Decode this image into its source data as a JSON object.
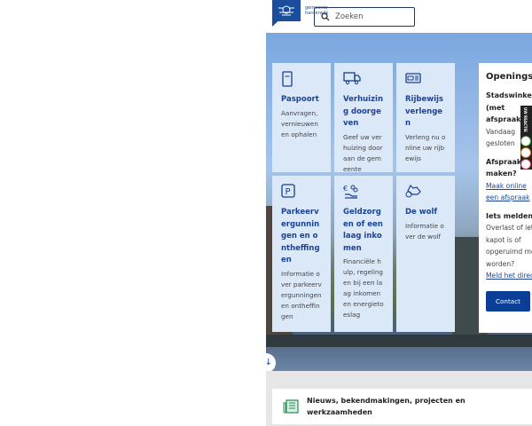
{
  "header": {
    "logo_text": "gemeente harderwijk",
    "search_placeholder": "Zoeken"
  },
  "cards": [
    {
      "icon": "passport-icon",
      "title": "Paspoort",
      "text": "Aanvragen, vernieuwen en ophalen"
    },
    {
      "icon": "moving-truck-icon",
      "title": "Verhuizing doorgeven",
      "text": "Geef uw verhuizing door aan de gemeente"
    },
    {
      "icon": "driving-license-icon",
      "title": "Rijbewijs verlengen",
      "text": "Verleng nu online uw rijbewijs"
    },
    {
      "icon": "parking-icon",
      "title": "Parkeervergunningen en ontheffingen",
      "text": "Informatie over parkeervergunningen en ontheffingen"
    },
    {
      "icon": "money-hand-icon",
      "title": "Geldzorgen of een laag inkomen",
      "text": "Financiële hulp, regelingen bij een laag inkomen en energietoeslag"
    },
    {
      "icon": "wolf-icon",
      "title": "De wolf",
      "text": "Informatie over de wolf"
    }
  ],
  "panel": {
    "title": "Openingstijden",
    "stadswinkel": "Stadswinkel (met afspraak)",
    "today": "Vandaag gesloten",
    "afspraak_title": "Afspraak maken?",
    "afspraak_link": "Maak online een afspraak",
    "melden_title": "Iets melden",
    "melden_text": "Overlast of iets dat kapot is of opgeruimd moet worden?",
    "melden_link": "Meld het direct",
    "contact": "Contact"
  },
  "feedback": {
    "label": "UW REACTIE"
  },
  "news": {
    "label": "Nieuws, bekendmakingen, projecten en werkzaamheden"
  }
}
